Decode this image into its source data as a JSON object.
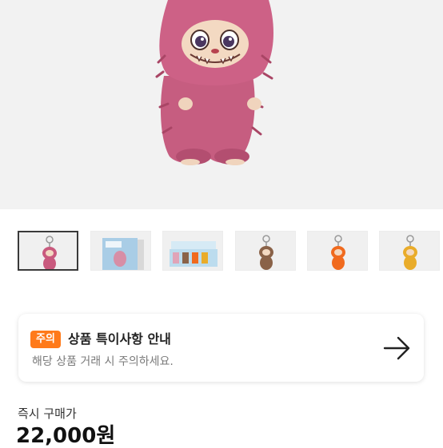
{
  "hero": {
    "image": "pink-plush-monster-doll",
    "colors": {
      "fur": "#c65d80",
      "fur_shade": "#a94565",
      "face": "#f3d9c2",
      "background": "#f2f2f2"
    }
  },
  "thumbnails": [
    {
      "image": "pink-keychain-plush",
      "selected": true,
      "color": "#c95a7e"
    },
    {
      "image": "blind-box-package",
      "selected": false,
      "color": "#a9cde6"
    },
    {
      "image": "blind-box-set",
      "selected": false,
      "color": "#bcdcee"
    },
    {
      "image": "brown-keychain-plush",
      "selected": false,
      "color": "#8a6248"
    },
    {
      "image": "orange-keychain-plush",
      "selected": false,
      "color": "#f06a1e"
    },
    {
      "image": "yellow-keychain-plush",
      "selected": false,
      "color": "#e9ac2a"
    }
  ],
  "notice": {
    "badge": "주의",
    "title": "상품 특이사항 안내",
    "description": "해당 상품 거래 시 주의하세요.",
    "icon": "arrow-right-icon",
    "badge_color": "#ff7a1a"
  },
  "price": {
    "label": "즉시 구매가",
    "value": "22,000원"
  }
}
